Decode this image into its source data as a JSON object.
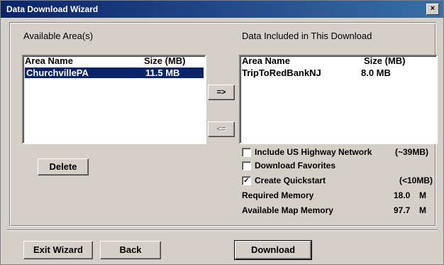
{
  "window": {
    "title": "Data Download Wizard",
    "close_glyph": "×"
  },
  "available": {
    "heading": "Available Area(s)",
    "col_name": "Area Name",
    "col_size": "Size (MB)",
    "rows": [
      {
        "name": "ChurchvillePA",
        "size": "11.5 MB",
        "selected": true
      }
    ]
  },
  "included": {
    "heading": "Data Included in This Download",
    "col_name": "Area Name",
    "col_size": "Size (MB)",
    "rows": [
      {
        "name": "TripToRedBankNJ",
        "size": "8.0 MB"
      }
    ]
  },
  "buttons": {
    "add": "=>",
    "remove": "<=",
    "delete": "Delete",
    "exit": "Exit Wizard",
    "back": "Back",
    "download": "Download"
  },
  "options": {
    "highway": {
      "label": "Include US Highway Network",
      "size": "(~39MB)",
      "checked": false
    },
    "favorites": {
      "label": "Download Favorites",
      "checked": false
    },
    "quickstart": {
      "label": "Create Quickstart",
      "size": "(<10MB)",
      "checked": true,
      "check_glyph": "✓"
    }
  },
  "memory": {
    "required_label": "Required Memory",
    "required_value": "18.0",
    "required_unit": "M",
    "available_label": "Available Map Memory",
    "available_value": "97.7",
    "available_unit": "M"
  }
}
